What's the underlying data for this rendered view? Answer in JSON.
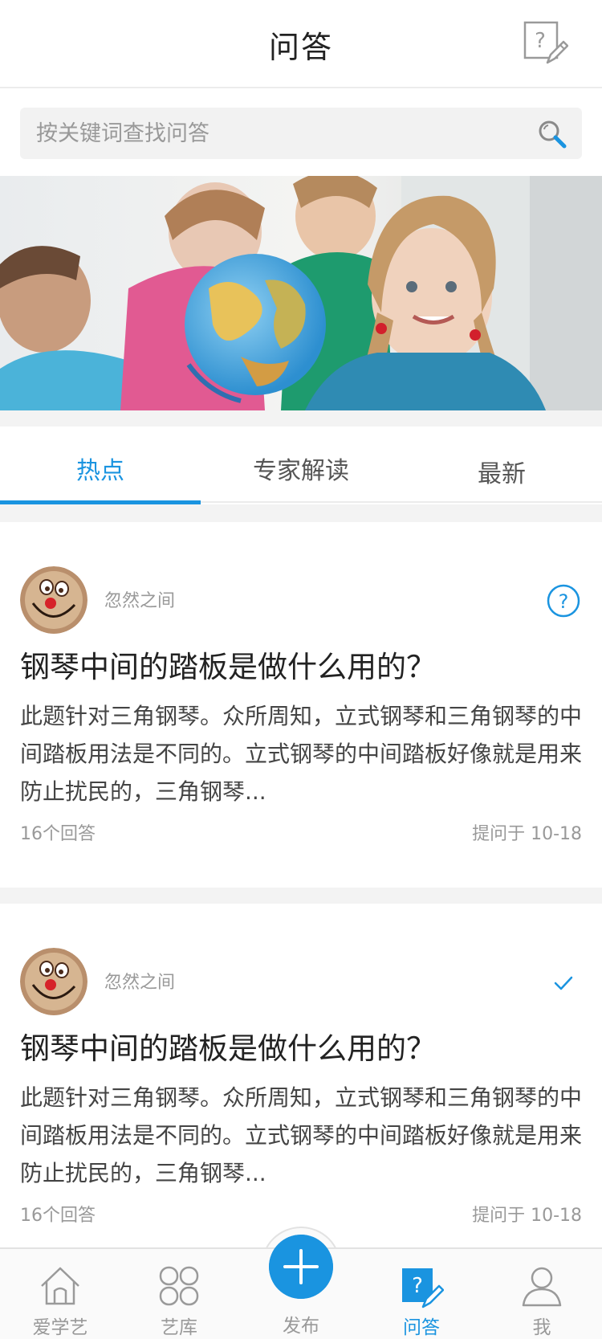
{
  "header": {
    "title": "问答",
    "ask_icon": "question-edit-icon"
  },
  "search": {
    "placeholder": "按关键词查找问答",
    "icon": "search-icon"
  },
  "tabs": [
    {
      "label": "热点",
      "active": true
    },
    {
      "label": "专家解读",
      "active": false
    },
    {
      "label": "最新",
      "active": false
    }
  ],
  "questions": [
    {
      "author": "忽然之间",
      "status_icon": "question-circle-icon",
      "title": "钢琴中间的踏板是做什么用的？",
      "body": "此题针对三角钢琴。众所周知，立式钢琴和三角钢琴的中间踏板用法是不同的。立式钢琴的中间踏板好像就是用来防止扰民的，三角钢琴...",
      "answers": "16个回答",
      "time": "提问于 10-18"
    },
    {
      "author": "忽然之间",
      "status_icon": "check-icon",
      "title": "钢琴中间的踏板是做什么用的？",
      "body": "此题针对三角钢琴。众所周知，立式钢琴和三角钢琴的中间踏板用法是不同的。立式钢琴的中间踏板好像就是用来防止扰民的，三角钢琴...",
      "answers": "16个回答",
      "time": "提问于 10-18"
    }
  ],
  "tabbar": {
    "home": "爱学艺",
    "library": "艺库",
    "publish": "发布",
    "qa": "问答",
    "me": "我",
    "active": "qa"
  },
  "colors": {
    "accent": "#1a94e0",
    "background": "#f3f3f3",
    "text": "#222222",
    "muted": "#999999"
  }
}
